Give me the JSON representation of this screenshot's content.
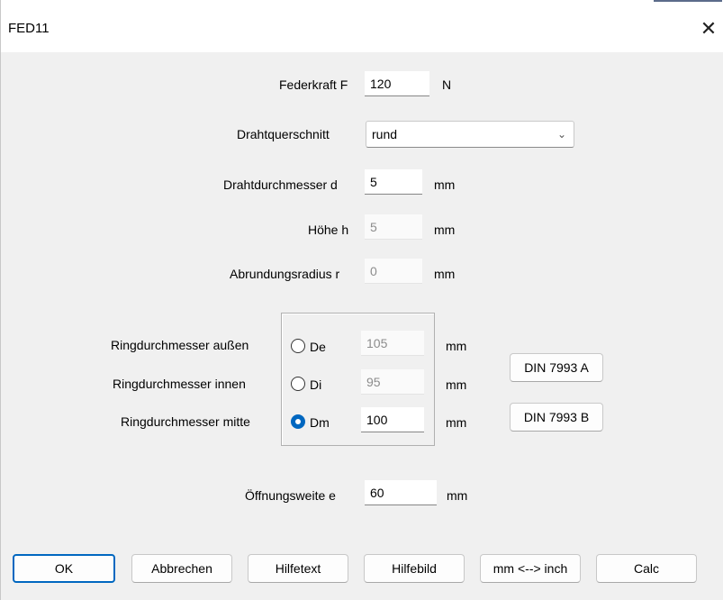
{
  "window": {
    "title": "FED11",
    "close_glyph": "✕"
  },
  "fields": {
    "federkraft": {
      "label": "Federkraft F",
      "value": "120",
      "unit": "N"
    },
    "drahtquerschnitt": {
      "label": "Drahtquerschnitt",
      "selected": "rund"
    },
    "drahtdurchmesser": {
      "label": "Drahtdurchmesser d",
      "value": "5",
      "unit": "mm"
    },
    "hoehe": {
      "label": "Höhe h",
      "value": "5",
      "unit": "mm"
    },
    "abrundungsradius": {
      "label": "Abrundungsradius r",
      "value": "0",
      "unit": "mm"
    }
  },
  "ring": {
    "aussen": {
      "label": "Ringdurchmesser außen",
      "option": "De",
      "value": "105",
      "unit": "mm",
      "selected": false
    },
    "innen": {
      "label": "Ringdurchmesser innen",
      "option": "Di",
      "value": "95",
      "unit": "mm",
      "selected": false
    },
    "mitte": {
      "label": "Ringdurchmesser mitte",
      "option": "Dm",
      "value": "100",
      "unit": "mm",
      "selected": true
    }
  },
  "din_buttons": {
    "a": "DIN 7993 A",
    "b": "DIN 7993 B"
  },
  "oeffnung": {
    "label": "Öffnungsweite e",
    "value": "60",
    "unit": "mm"
  },
  "buttons": {
    "ok": "OK",
    "cancel": "Abbrechen",
    "helptext": "Hilfetext",
    "helpimage": "Hilfebild",
    "units": "mm <--> inch",
    "calc": "Calc"
  },
  "colors": {
    "accent": "#0067c0",
    "background": "#f0f0f0"
  }
}
